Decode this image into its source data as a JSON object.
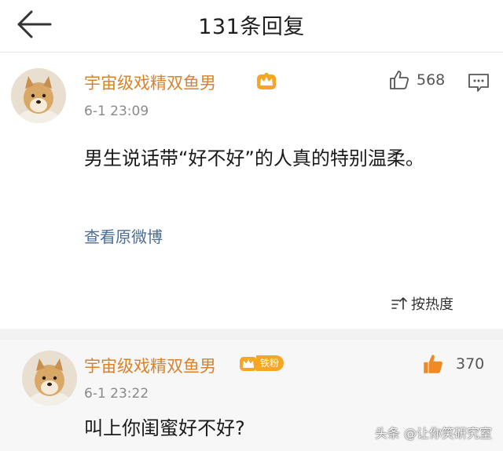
{
  "header": {
    "title": "131条回复"
  },
  "main_comment": {
    "username": "宇宙级戏精双鱼男",
    "timestamp": "6-1 23:09",
    "likes": "568",
    "text": "男生说话带“好不好”的人真的特别温柔。",
    "view_original": "查看原微博"
  },
  "sort": {
    "label": "按热度"
  },
  "reply": {
    "username": "宇宙级戏精双鱼男",
    "fan_badge": "铁粉",
    "timestamp": "6-1 23:22",
    "likes": "370",
    "text": "叫上你闺蜜好不好?"
  },
  "watermark": "头条 @让你笑研究室",
  "colors": {
    "username": "#d9822b",
    "link": "#4a6c95",
    "like_active": "#f08a24",
    "fan_badge": "#f5a623"
  }
}
